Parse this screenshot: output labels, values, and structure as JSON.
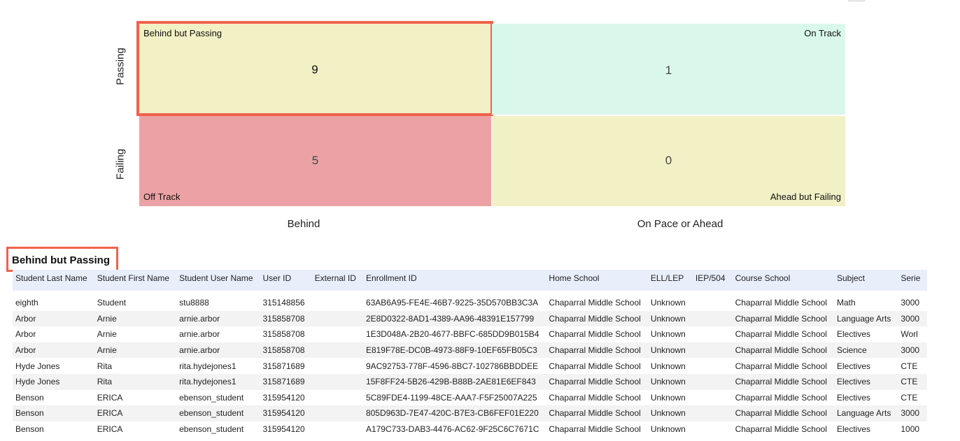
{
  "matrix": {
    "y_labels": {
      "passing": "Passing",
      "failing": "Failing"
    },
    "x_labels": {
      "behind": "Behind",
      "on_pace": "On Pace or Ahead"
    },
    "cells": {
      "behind_but_passing": {
        "label": "Behind but Passing",
        "count": "9",
        "color": "#f2f0c5",
        "selected": true
      },
      "on_track": {
        "label": "On Track",
        "count": "1",
        "color": "#daf7eb"
      },
      "off_track": {
        "label": "Off Track",
        "count": "5",
        "color": "#eca2a5"
      },
      "ahead_but_failing": {
        "label": "Ahead but Failing",
        "count": "0",
        "color": "#f2f0c5"
      }
    },
    "highlight_color": "#f0624b"
  },
  "section": {
    "title": "Behind but Passing"
  },
  "table": {
    "columns": [
      "Student Last Name",
      "Student First Name",
      "Student User Name",
      "User ID",
      "External ID",
      "Enrollment ID",
      "Home School",
      "ELL/LEP",
      "IEP/504",
      "Course School",
      "Subject",
      "Serie"
    ],
    "rows": [
      [
        "eighth",
        "Student",
        "stu8888",
        "315148856",
        "",
        "63AB6A95-FE4E-46B7-9225-35D570BB3C3A",
        "Chaparral Middle School",
        "Unknown",
        "",
        "Chaparral Middle School",
        "Math",
        "3000"
      ],
      [
        "Arbor",
        "Arnie",
        "arnie.arbor",
        "315858708",
        "",
        "2E8D0322-8AD1-4389-AA96-48391E157799",
        "Chaparral Middle School",
        "Unknown",
        "",
        "Chaparral Middle School",
        "Language Arts",
        "3000"
      ],
      [
        "Arbor",
        "Arnie",
        "arnie.arbor",
        "315858708",
        "",
        "1E3D048A-2B20-4677-BBFC-685DD9B015B4",
        "Chaparral Middle School",
        "Unknown",
        "",
        "Chaparral Middle School",
        "Electives",
        "Worl"
      ],
      [
        "Arbor",
        "Arnie",
        "arnie.arbor",
        "315858708",
        "",
        "E819F78E-DC0B-4973-88F9-10EF65FB05C3",
        "Chaparral Middle School",
        "Unknown",
        "",
        "Chaparral Middle School",
        "Science",
        "3000"
      ],
      [
        "Hyde Jones",
        "Rita",
        "rita.hydejones1",
        "315871689",
        "",
        "9AC92753-778F-4596-8BC7-102786BBDDEE",
        "Chaparral Middle School",
        "Unknown",
        "",
        "Chaparral Middle School",
        "Electives",
        "CTE"
      ],
      [
        "Hyde Jones",
        "Rita",
        "rita.hydejones1",
        "315871689",
        "",
        "15F8FF24-5B26-429B-B88B-2AE81E6EF843",
        "Chaparral Middle School",
        "Unknown",
        "",
        "Chaparral Middle School",
        "Electives",
        "CTE"
      ],
      [
        "Benson",
        "ERICA",
        "ebenson_student",
        "315954120",
        "",
        "5C89FDE4-1199-48CE-AAA7-F5F25007A225",
        "Chaparral Middle School",
        "Unknown",
        "",
        "Chaparral Middle School",
        "Electives",
        "CTE"
      ],
      [
        "Benson",
        "ERICA",
        "ebenson_student",
        "315954120",
        "",
        "805D963D-7E47-420C-B7E3-CB6FEF01E220",
        "Chaparral Middle School",
        "Unknown",
        "",
        "Chaparral Middle School",
        "Language Arts",
        "3000"
      ],
      [
        "Benson",
        "ERICA",
        "ebenson_student",
        "315954120",
        "",
        "A179C733-DAB3-4476-AC62-9F25C6C7671C",
        "Chaparral Middle School",
        "Unknown",
        "",
        "Chaparral Middle School",
        "Electives",
        "1000"
      ]
    ]
  }
}
